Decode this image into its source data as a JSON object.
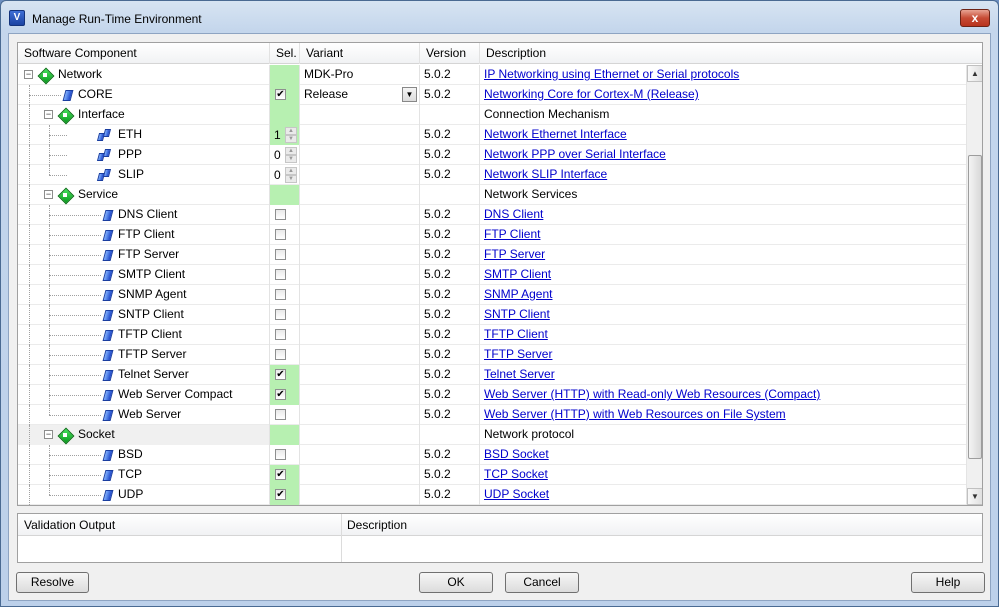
{
  "window": {
    "title": "Manage Run-Time Environment",
    "app_icon": "V",
    "close": "x"
  },
  "grid": {
    "headers": {
      "component": "Software Component",
      "sel": "Sel.",
      "variant": "Variant",
      "version": "Version",
      "description": "Description"
    },
    "rows": [
      {
        "name": "Network",
        "variant": "MDK-Pro",
        "version": "5.0.2",
        "desc": "IP Networking using Ethernet or Serial protocols",
        "link": true
      },
      {
        "name": "CORE",
        "sel": "✔",
        "variant": "Release",
        "version": "5.0.2",
        "desc": "Networking Core for Cortex-M (Release)",
        "link": true
      },
      {
        "name": "Interface",
        "desc": "Connection Mechanism"
      },
      {
        "name": "ETH",
        "count": "1",
        "version": "5.0.2",
        "desc": "Network Ethernet Interface",
        "link": true
      },
      {
        "name": "PPP",
        "count": "0",
        "version": "5.0.2",
        "desc": "Network PPP over Serial Interface",
        "link": true
      },
      {
        "name": "SLIP",
        "count": "0",
        "version": "5.0.2",
        "desc": "Network SLIP Interface",
        "link": true
      },
      {
        "name": "Service",
        "desc": "Network Services"
      },
      {
        "name": "DNS Client",
        "sel": "",
        "version": "5.0.2",
        "desc": "DNS Client",
        "link": true
      },
      {
        "name": "FTP Client",
        "sel": "",
        "version": "5.0.2",
        "desc": "FTP Client",
        "link": true
      },
      {
        "name": "FTP Server",
        "sel": "",
        "version": "5.0.2",
        "desc": "FTP Server",
        "link": true
      },
      {
        "name": "SMTP Client",
        "sel": "",
        "version": "5.0.2",
        "desc": "SMTP Client",
        "link": true
      },
      {
        "name": "SNMP Agent",
        "sel": "",
        "version": "5.0.2",
        "desc": "SNMP Agent",
        "link": true
      },
      {
        "name": "SNTP Client",
        "sel": "",
        "version": "5.0.2",
        "desc": "SNTP Client",
        "link": true
      },
      {
        "name": "TFTP Client",
        "sel": "",
        "version": "5.0.2",
        "desc": "TFTP Client",
        "link": true
      },
      {
        "name": "TFTP Server",
        "sel": "",
        "version": "5.0.2",
        "desc": "TFTP Server",
        "link": true
      },
      {
        "name": "Telnet Server",
        "sel": "✔",
        "version": "5.0.2",
        "desc": "Telnet Server",
        "link": true
      },
      {
        "name": "Web Server Compact",
        "sel": "✔",
        "version": "5.0.2",
        "desc": "Web Server (HTTP) with Read-only Web Resources (Compact)",
        "link": true
      },
      {
        "name": "Web Server",
        "sel": "",
        "version": "5.0.2",
        "desc": "Web Server (HTTP) with Web Resources on File System",
        "link": true
      },
      {
        "name": "Socket",
        "desc": "Network protocol"
      },
      {
        "name": "BSD",
        "sel": "",
        "version": "5.0.2",
        "desc": "BSD Socket",
        "link": true
      },
      {
        "name": "TCP",
        "sel": "✔",
        "version": "5.0.2",
        "desc": "TCP Socket",
        "link": true
      },
      {
        "name": "UDP",
        "sel": "✔",
        "version": "5.0.2",
        "desc": "UDP Socket",
        "link": true
      }
    ]
  },
  "validation": {
    "output_header": "Validation Output",
    "description_header": "Description"
  },
  "buttons": {
    "resolve": "Resolve",
    "ok": "OK",
    "cancel": "Cancel",
    "help": "Help"
  },
  "glyphs": {
    "expander_collapse": "−",
    "combo_arrow": "▼",
    "scroll_up": "▲",
    "scroll_down": "▼",
    "spin_up": "▲",
    "spin_down": "▼"
  }
}
